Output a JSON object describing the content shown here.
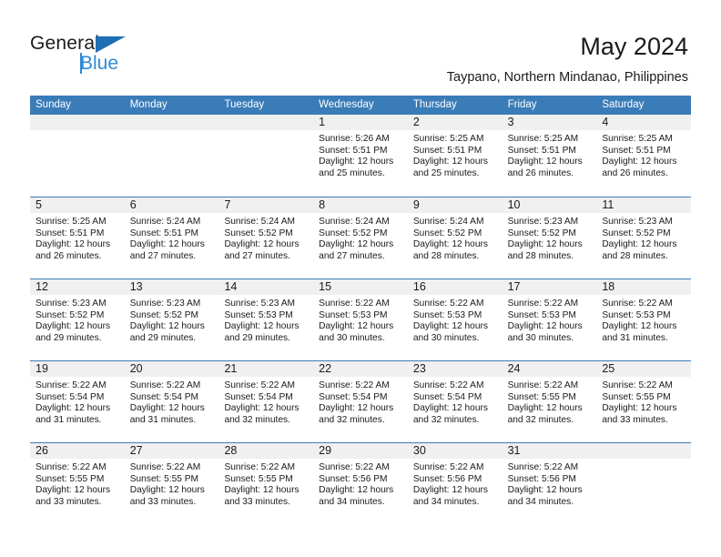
{
  "logo": {
    "word_one": "General",
    "word_two": "Blue",
    "accent_color": "#1f6fb5",
    "secondary_color": "#2e8bd6"
  },
  "header": {
    "title": "May 2024",
    "subtitle": "Taypano, Northern Mindanao, Philippines"
  },
  "theme": {
    "header_band": "#3a7cb8",
    "day_number_band": "#f0f0f0",
    "text": "#1a1a1a"
  },
  "weekdays": [
    "Sunday",
    "Monday",
    "Tuesday",
    "Wednesday",
    "Thursday",
    "Friday",
    "Saturday"
  ],
  "weeks": [
    [
      {
        "day": "",
        "sunrise": "",
        "sunset": "",
        "daylight_line1": "",
        "daylight_line2": ""
      },
      {
        "day": "",
        "sunrise": "",
        "sunset": "",
        "daylight_line1": "",
        "daylight_line2": ""
      },
      {
        "day": "",
        "sunrise": "",
        "sunset": "",
        "daylight_line1": "",
        "daylight_line2": ""
      },
      {
        "day": "1",
        "sunrise": "Sunrise: 5:26 AM",
        "sunset": "Sunset: 5:51 PM",
        "daylight_line1": "Daylight: 12 hours",
        "daylight_line2": "and 25 minutes."
      },
      {
        "day": "2",
        "sunrise": "Sunrise: 5:25 AM",
        "sunset": "Sunset: 5:51 PM",
        "daylight_line1": "Daylight: 12 hours",
        "daylight_line2": "and 25 minutes."
      },
      {
        "day": "3",
        "sunrise": "Sunrise: 5:25 AM",
        "sunset": "Sunset: 5:51 PM",
        "daylight_line1": "Daylight: 12 hours",
        "daylight_line2": "and 26 minutes."
      },
      {
        "day": "4",
        "sunrise": "Sunrise: 5:25 AM",
        "sunset": "Sunset: 5:51 PM",
        "daylight_line1": "Daylight: 12 hours",
        "daylight_line2": "and 26 minutes."
      }
    ],
    [
      {
        "day": "5",
        "sunrise": "Sunrise: 5:25 AM",
        "sunset": "Sunset: 5:51 PM",
        "daylight_line1": "Daylight: 12 hours",
        "daylight_line2": "and 26 minutes."
      },
      {
        "day": "6",
        "sunrise": "Sunrise: 5:24 AM",
        "sunset": "Sunset: 5:51 PM",
        "daylight_line1": "Daylight: 12 hours",
        "daylight_line2": "and 27 minutes."
      },
      {
        "day": "7",
        "sunrise": "Sunrise: 5:24 AM",
        "sunset": "Sunset: 5:52 PM",
        "daylight_line1": "Daylight: 12 hours",
        "daylight_line2": "and 27 minutes."
      },
      {
        "day": "8",
        "sunrise": "Sunrise: 5:24 AM",
        "sunset": "Sunset: 5:52 PM",
        "daylight_line1": "Daylight: 12 hours",
        "daylight_line2": "and 27 minutes."
      },
      {
        "day": "9",
        "sunrise": "Sunrise: 5:24 AM",
        "sunset": "Sunset: 5:52 PM",
        "daylight_line1": "Daylight: 12 hours",
        "daylight_line2": "and 28 minutes."
      },
      {
        "day": "10",
        "sunrise": "Sunrise: 5:23 AM",
        "sunset": "Sunset: 5:52 PM",
        "daylight_line1": "Daylight: 12 hours",
        "daylight_line2": "and 28 minutes."
      },
      {
        "day": "11",
        "sunrise": "Sunrise: 5:23 AM",
        "sunset": "Sunset: 5:52 PM",
        "daylight_line1": "Daylight: 12 hours",
        "daylight_line2": "and 28 minutes."
      }
    ],
    [
      {
        "day": "12",
        "sunrise": "Sunrise: 5:23 AM",
        "sunset": "Sunset: 5:52 PM",
        "daylight_line1": "Daylight: 12 hours",
        "daylight_line2": "and 29 minutes."
      },
      {
        "day": "13",
        "sunrise": "Sunrise: 5:23 AM",
        "sunset": "Sunset: 5:52 PM",
        "daylight_line1": "Daylight: 12 hours",
        "daylight_line2": "and 29 minutes."
      },
      {
        "day": "14",
        "sunrise": "Sunrise: 5:23 AM",
        "sunset": "Sunset: 5:53 PM",
        "daylight_line1": "Daylight: 12 hours",
        "daylight_line2": "and 29 minutes."
      },
      {
        "day": "15",
        "sunrise": "Sunrise: 5:22 AM",
        "sunset": "Sunset: 5:53 PM",
        "daylight_line1": "Daylight: 12 hours",
        "daylight_line2": "and 30 minutes."
      },
      {
        "day": "16",
        "sunrise": "Sunrise: 5:22 AM",
        "sunset": "Sunset: 5:53 PM",
        "daylight_line1": "Daylight: 12 hours",
        "daylight_line2": "and 30 minutes."
      },
      {
        "day": "17",
        "sunrise": "Sunrise: 5:22 AM",
        "sunset": "Sunset: 5:53 PM",
        "daylight_line1": "Daylight: 12 hours",
        "daylight_line2": "and 30 minutes."
      },
      {
        "day": "18",
        "sunrise": "Sunrise: 5:22 AM",
        "sunset": "Sunset: 5:53 PM",
        "daylight_line1": "Daylight: 12 hours",
        "daylight_line2": "and 31 minutes."
      }
    ],
    [
      {
        "day": "19",
        "sunrise": "Sunrise: 5:22 AM",
        "sunset": "Sunset: 5:54 PM",
        "daylight_line1": "Daylight: 12 hours",
        "daylight_line2": "and 31 minutes."
      },
      {
        "day": "20",
        "sunrise": "Sunrise: 5:22 AM",
        "sunset": "Sunset: 5:54 PM",
        "daylight_line1": "Daylight: 12 hours",
        "daylight_line2": "and 31 minutes."
      },
      {
        "day": "21",
        "sunrise": "Sunrise: 5:22 AM",
        "sunset": "Sunset: 5:54 PM",
        "daylight_line1": "Daylight: 12 hours",
        "daylight_line2": "and 32 minutes."
      },
      {
        "day": "22",
        "sunrise": "Sunrise: 5:22 AM",
        "sunset": "Sunset: 5:54 PM",
        "daylight_line1": "Daylight: 12 hours",
        "daylight_line2": "and 32 minutes."
      },
      {
        "day": "23",
        "sunrise": "Sunrise: 5:22 AM",
        "sunset": "Sunset: 5:54 PM",
        "daylight_line1": "Daylight: 12 hours",
        "daylight_line2": "and 32 minutes."
      },
      {
        "day": "24",
        "sunrise": "Sunrise: 5:22 AM",
        "sunset": "Sunset: 5:55 PM",
        "daylight_line1": "Daylight: 12 hours",
        "daylight_line2": "and 32 minutes."
      },
      {
        "day": "25",
        "sunrise": "Sunrise: 5:22 AM",
        "sunset": "Sunset: 5:55 PM",
        "daylight_line1": "Daylight: 12 hours",
        "daylight_line2": "and 33 minutes."
      }
    ],
    [
      {
        "day": "26",
        "sunrise": "Sunrise: 5:22 AM",
        "sunset": "Sunset: 5:55 PM",
        "daylight_line1": "Daylight: 12 hours",
        "daylight_line2": "and 33 minutes."
      },
      {
        "day": "27",
        "sunrise": "Sunrise: 5:22 AM",
        "sunset": "Sunset: 5:55 PM",
        "daylight_line1": "Daylight: 12 hours",
        "daylight_line2": "and 33 minutes."
      },
      {
        "day": "28",
        "sunrise": "Sunrise: 5:22 AM",
        "sunset": "Sunset: 5:55 PM",
        "daylight_line1": "Daylight: 12 hours",
        "daylight_line2": "and 33 minutes."
      },
      {
        "day": "29",
        "sunrise": "Sunrise: 5:22 AM",
        "sunset": "Sunset: 5:56 PM",
        "daylight_line1": "Daylight: 12 hours",
        "daylight_line2": "and 34 minutes."
      },
      {
        "day": "30",
        "sunrise": "Sunrise: 5:22 AM",
        "sunset": "Sunset: 5:56 PM",
        "daylight_line1": "Daylight: 12 hours",
        "daylight_line2": "and 34 minutes."
      },
      {
        "day": "31",
        "sunrise": "Sunrise: 5:22 AM",
        "sunset": "Sunset: 5:56 PM",
        "daylight_line1": "Daylight: 12 hours",
        "daylight_line2": "and 34 minutes."
      },
      {
        "day": "",
        "sunrise": "",
        "sunset": "",
        "daylight_line1": "",
        "daylight_line2": ""
      }
    ]
  ]
}
